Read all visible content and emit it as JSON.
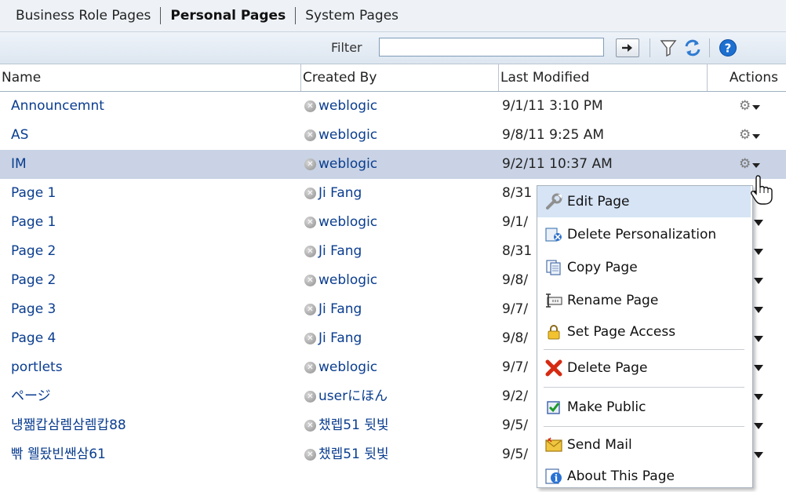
{
  "tabs": [
    {
      "label": "Business Role Pages"
    },
    {
      "label": "Personal Pages"
    },
    {
      "label": "System Pages"
    }
  ],
  "toolbar": {
    "filter_label": "Filter",
    "filter_value": "",
    "icons": [
      "go-arrow-icon",
      "funnel-filter-icon",
      "refresh-icon",
      "help-icon"
    ]
  },
  "columns": {
    "name": "Name",
    "created_by": "Created By",
    "last_modified": "Last Modified",
    "actions": "Actions"
  },
  "rows": [
    {
      "name": "Announcemnt",
      "created_by": "weblogic",
      "modified": "9/1/11 3:10 PM"
    },
    {
      "name": "AS",
      "created_by": "weblogic",
      "modified": "9/8/11 9:25 AM"
    },
    {
      "name": "IM",
      "created_by": "weblogic",
      "modified": "9/2/11 10:37 AM",
      "selected": true
    },
    {
      "name": "Page 1",
      "created_by": "Ji Fang",
      "modified": "8/31"
    },
    {
      "name": "Page 1",
      "created_by": "weblogic",
      "modified": "9/1/"
    },
    {
      "name": "Page 2",
      "created_by": "Ji Fang",
      "modified": "8/31"
    },
    {
      "name": "Page 2",
      "created_by": "weblogic",
      "modified": "9/8/"
    },
    {
      "name": "Page 3",
      "created_by": "Ji Fang",
      "modified": "9/7/"
    },
    {
      "name": "Page 4",
      "created_by": "Ji Fang",
      "modified": "9/8/"
    },
    {
      "name": "portlets",
      "created_by": "weblogic",
      "modified": "9/7/"
    },
    {
      "name": "ページ",
      "created_by": "userにほん",
      "modified": "9/2/"
    },
    {
      "name": "넁쨂캅삼렘삼렘캅88",
      "created_by": "챘렙51 뒷빛",
      "modified": "9/5/"
    },
    {
      "name": "빢 웰돴빈쌘삼61",
      "created_by": "챘렙51 뒷빛",
      "modified": "9/5/"
    }
  ],
  "menu": {
    "items": [
      {
        "label": "Edit Page",
        "icon": "wrench-icon",
        "highlighted": true
      },
      {
        "label": "Delete Personalization",
        "icon": "delete-personalization-icon"
      },
      {
        "label": "Copy Page",
        "icon": "copy-page-icon"
      },
      {
        "label": "Rename Page",
        "icon": "rename-page-icon"
      },
      {
        "label": "Set Page Access",
        "icon": "lock-icon"
      },
      {
        "label": "Delete Page",
        "icon": "red-x-icon"
      },
      {
        "label": "Make Public",
        "icon": "checkbox-icon"
      },
      {
        "label": "Send Mail",
        "icon": "envelope-icon"
      },
      {
        "label": "About This Page",
        "icon": "info-icon"
      }
    ]
  },
  "colors": {
    "link": "#0a3d8f",
    "selected_row": "#c9d3e5",
    "menu_highlight": "#d6e4f5",
    "tab_bar": "#eef2f7"
  }
}
